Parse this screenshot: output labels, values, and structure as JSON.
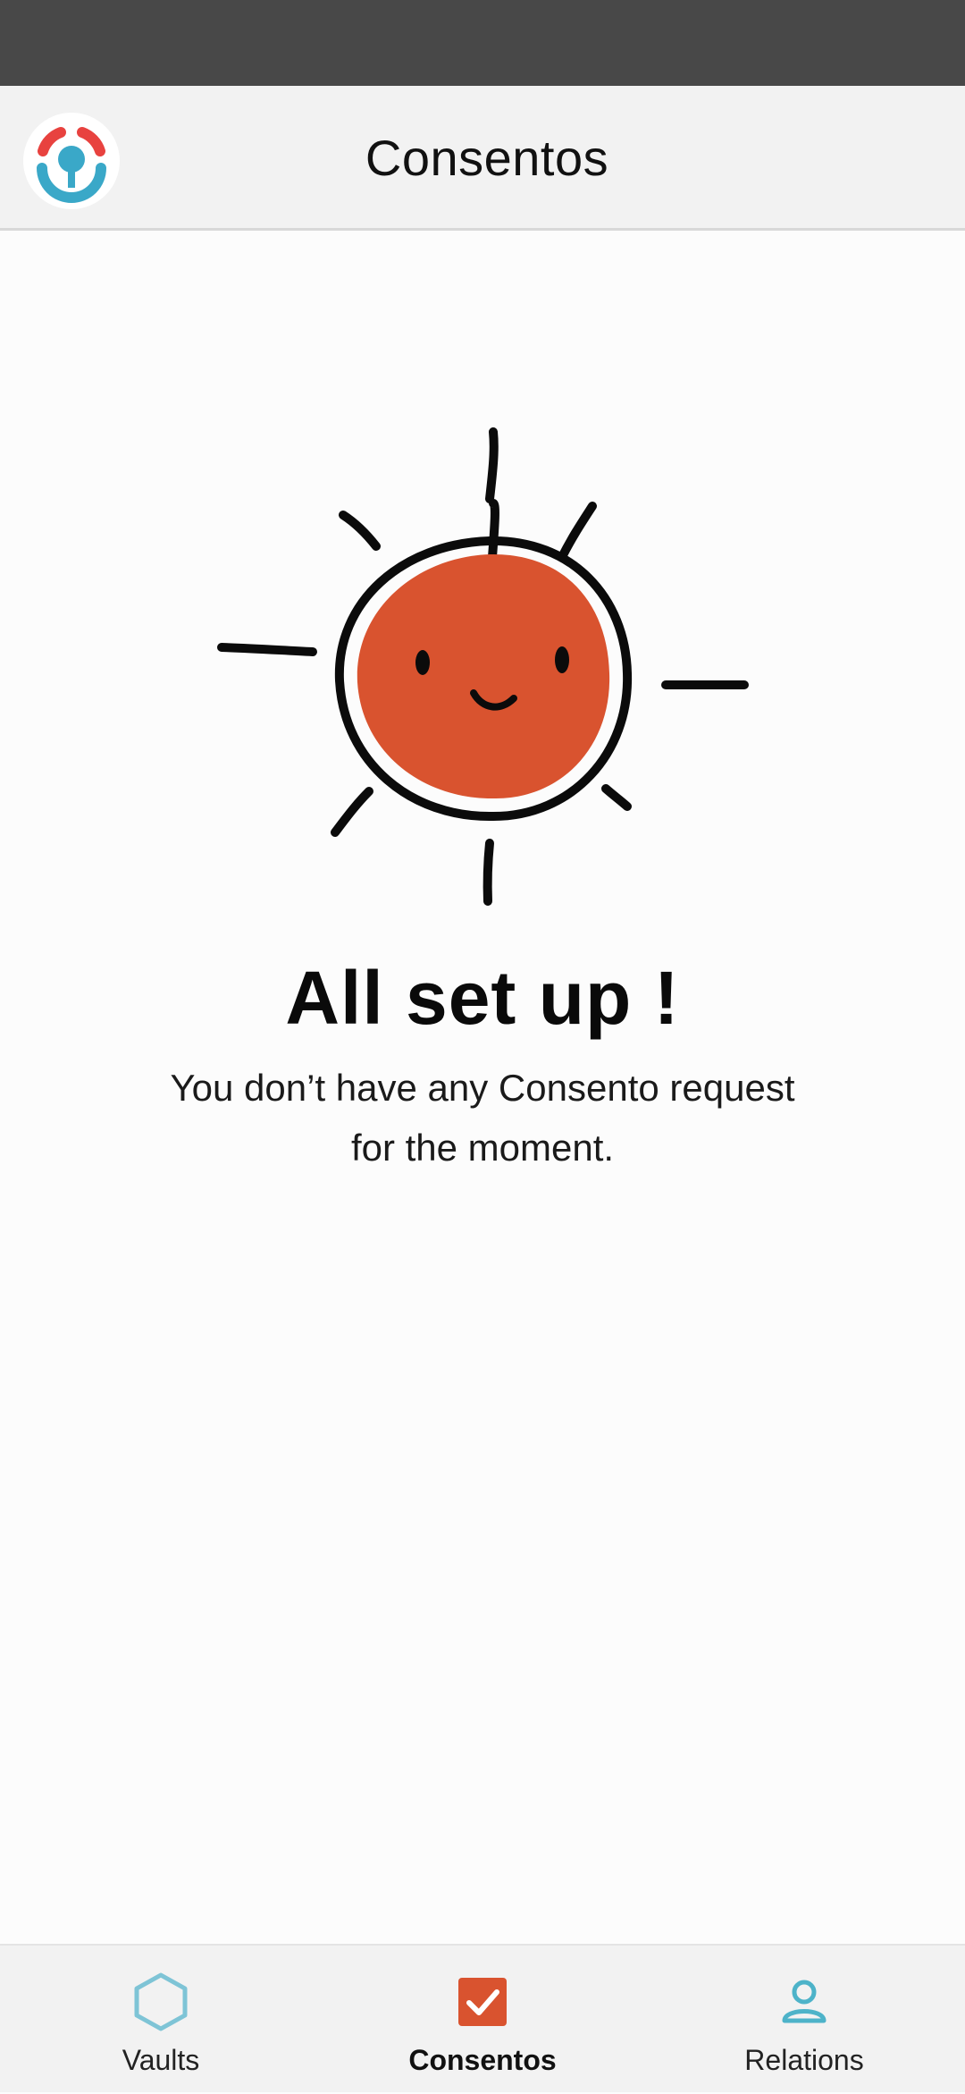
{
  "app_bar": {
    "logo_icon": "consento-logo-icon",
    "title": "Consentos"
  },
  "empty_state": {
    "illustration": "smiling-sun-icon",
    "title": "All set up !",
    "message": "You don’t have any Consento request for the moment."
  },
  "bottom_nav": {
    "items": [
      {
        "label": "Vaults",
        "icon": "hexagon-icon",
        "active": false
      },
      {
        "label": "Consentos",
        "icon": "checkbox-checked-icon",
        "active": true
      },
      {
        "label": "Relations",
        "icon": "person-icon",
        "active": false
      }
    ]
  },
  "colors": {
    "accent_orange": "#d9532f",
    "accent_teal": "#4db3c9",
    "logo_red": "#e8423f",
    "status_bar": "#484848"
  }
}
